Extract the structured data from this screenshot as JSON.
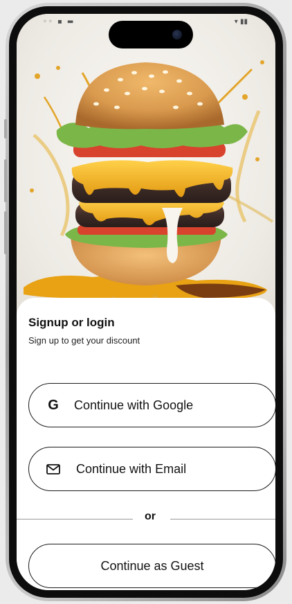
{
  "auth": {
    "title": "Signup or login",
    "subtitle": "Sign up to get your discount",
    "google_icon_letter": "G",
    "google_label": "Continue with Google",
    "email_label": "Continue with Email",
    "divider_text": "or",
    "guest_label": "Continue as Guest"
  },
  "hero": {
    "image": "burger-splash-photo",
    "colors": {
      "bun": "#d99a4e",
      "cheese": "#f2b324",
      "patty": "#4a3530",
      "lettuce": "#6aa83a",
      "tomato": "#d8432e"
    }
  },
  "icons": {
    "google": "google-g-icon",
    "email": "mail-icon"
  }
}
